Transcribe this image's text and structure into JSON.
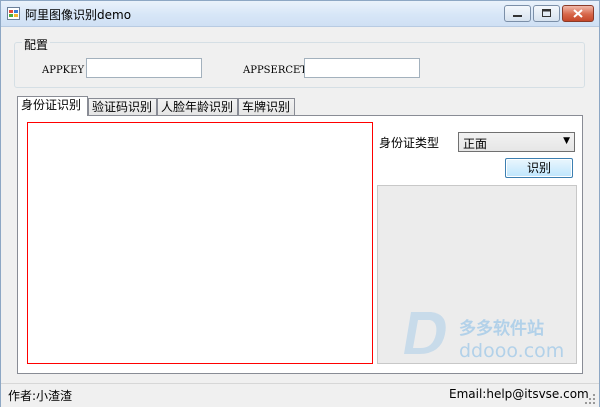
{
  "window": {
    "title": "阿里图像识别demo"
  },
  "config": {
    "group_title": "配置",
    "appkey_label": "APPKEY",
    "appkey_value": "",
    "appsercet_label": "APPSERCET",
    "appsercet_value": ""
  },
  "tabs": [
    {
      "label": "身份证识别",
      "active": true
    },
    {
      "label": "验证码识别",
      "active": false
    },
    {
      "label": "人脸年龄识别",
      "active": false
    },
    {
      "label": "车牌识别",
      "active": false
    }
  ],
  "idcard": {
    "type_label": "身份证类型",
    "type_selected": "正面",
    "recognize_button": "识别"
  },
  "watermark": {
    "brand": "多多软件站",
    "domain": "ddooo.com"
  },
  "status": {
    "author": "作者:小渣渣",
    "email": "Email:help@itsvse.com"
  },
  "colors": {
    "titlebar": "#d7e6f7",
    "image_border": "#ff0000",
    "close_button": "#c5472a"
  }
}
